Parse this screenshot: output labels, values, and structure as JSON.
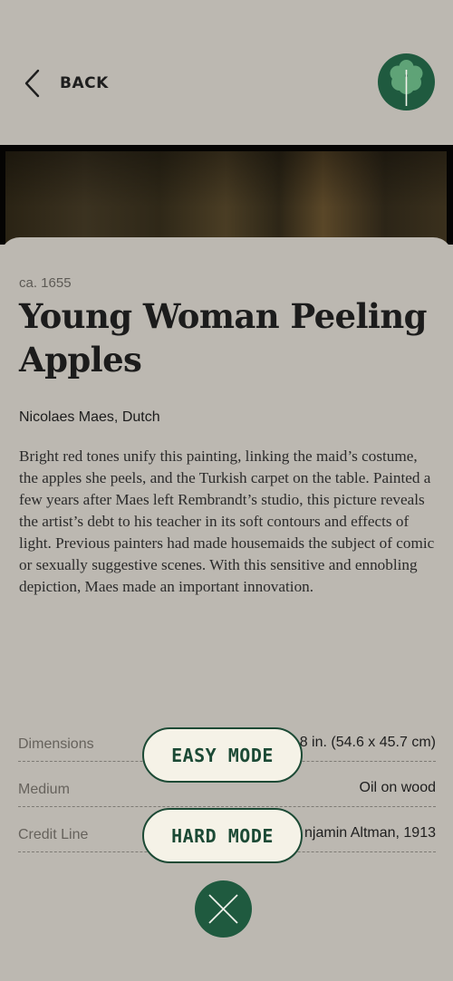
{
  "header": {
    "back_label": "BACK",
    "logo_icon": "tree-icon",
    "back_icon": "chevron-left-icon"
  },
  "artwork": {
    "date": "ca. 1655",
    "title": "Young Woman Peeling Apples",
    "artist": "Nicolaes Maes, Dutch",
    "description": "Bright red tones unify this painting, linking the maid’s costume, the apples she peels, and the Turkish carpet on the table. Painted a few years after Maes left Rembrandt’s studio, this picture reveals the artist’s debt to his teacher in its soft contours and effects of light. Previous painters had made housemaids the subject of comic or sexually suggestive scenes. With this sensitive and ennobling depiction, Maes made an important innovation."
  },
  "details": [
    {
      "label": "Dimensions",
      "value": "8 in. (54.6 x 45.7 cm)"
    },
    {
      "label": "Medium",
      "value": "Oil on wood"
    },
    {
      "label": "Credit Line",
      "value": "njamin Altman, 1913"
    }
  ],
  "modes": {
    "easy_label": "EASY MODE",
    "hard_label": "HARD MODE"
  },
  "close_icon": "close-icon",
  "colors": {
    "background": "#bcb8b1",
    "accent_green": "#1f5a3f",
    "button_fill": "#f5f2e7"
  }
}
